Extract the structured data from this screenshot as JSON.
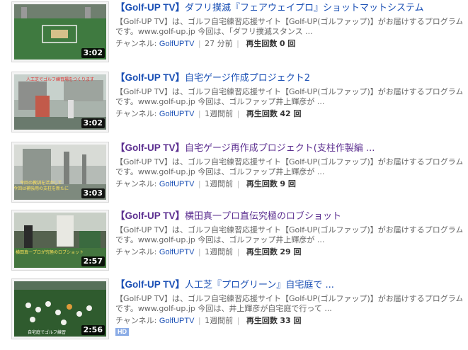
{
  "videos": [
    {
      "duration": "3:02",
      "title_brand": "【Golf-UP TV】",
      "title_text": "ダフリ撲滅『フェアウェイプロ』ショットマットシステム",
      "desc_line1": "【Golf-UP TV】は、ゴルフ自宅練習応援サイト【Golf-UP(ゴルファップ)】がお届けするプログラム",
      "desc_line2": "です。www.golf-up.jp 今回は、「ダフリ撲滅スタンス ...",
      "channel_label": "チャンネル:",
      "channel": "GolfUPTV",
      "time": "27 分前",
      "views_label": "再生回数",
      "views": "0 回"
    },
    {
      "duration": "3:02",
      "title_brand": "【Golf-UP TV】",
      "title_text": "自宅ゲージ作成プロジェクト2",
      "desc_line1": "【Golf-UP TV】は、ゴルフ自宅練習応援サイト【Golf-UP(ゴルファップ)】がお届けするプログラム",
      "desc_line2": "です。www.golf-up.jp 今回は、ゴルファップ井上輝彦が ...",
      "channel_label": "チャンネル:",
      "channel": "GolfUPTV",
      "time": "1週間前",
      "views_label": "再生回数",
      "views": "42 回"
    },
    {
      "duration": "3:03",
      "title_brand": "【Golf-UP TV】",
      "title_text": "自宅ゲージ再作成プロジェクト(支柱作製編 ...",
      "desc_line1": "【Golf-UP TV】は、ゴルフ自宅練習応援サイト【Golf-UP(ゴルファップ)】がお届けするプログラム",
      "desc_line2": "です。www.golf-up.jp 今回は、ゴルファップ井上輝彦が ...",
      "channel_label": "チャンネル:",
      "channel": "GolfUPTV",
      "time": "1週間前",
      "views_label": "再生回数",
      "views": "9 回"
    },
    {
      "duration": "2:57",
      "title_brand": "【Golf-UP TV】",
      "title_text": "横田真一プロ直伝究極のロブショット",
      "desc_line1": "【Golf-UP TV】は、ゴルフ自宅練習応援サイト【Golf-UP(ゴルファップ)】がお届けするプログラム",
      "desc_line2": "です。www.golf-up.jp 今回は、ゴルファップ井上輝彦が ...",
      "channel_label": "チャンネル:",
      "channel": "GolfUPTV",
      "time": "1週間前",
      "views_label": "再生回数",
      "views": "29 回"
    },
    {
      "duration": "2:56",
      "title_brand": "【Golf-UP TV】",
      "title_text": "人工芝『プログリーン』自宅庭で ...",
      "desc_line1": "【Golf-UP TV】は、ゴルフ自宅練習応援サイト【Golf-UP(ゴルファップ)】がお届けするプログラム",
      "desc_line2": "です。www.golf-up.jp 今回は、井上輝彦が自宅庭で行って ...",
      "channel_label": "チャンネル:",
      "channel": "GolfUPTV",
      "time": "1週間前",
      "views_label": "再生回数",
      "views": "33 回",
      "badge": "HD"
    }
  ],
  "thumb_captions": {
    "t2": "人工芝でゴルフ練習場をつくります",
    "t3a": "今回の教訓を活かして",
    "t3b": "今回は補強用の支柱を新たに",
    "t4": "横田真一プロが究極のロブショット",
    "t5": "自宅庭でゴルフ練習"
  },
  "colors": {
    "link": "#1b50b5",
    "visited": "#5c2f90",
    "meta_text": "#666666",
    "hd_badge": "#8bace6"
  }
}
